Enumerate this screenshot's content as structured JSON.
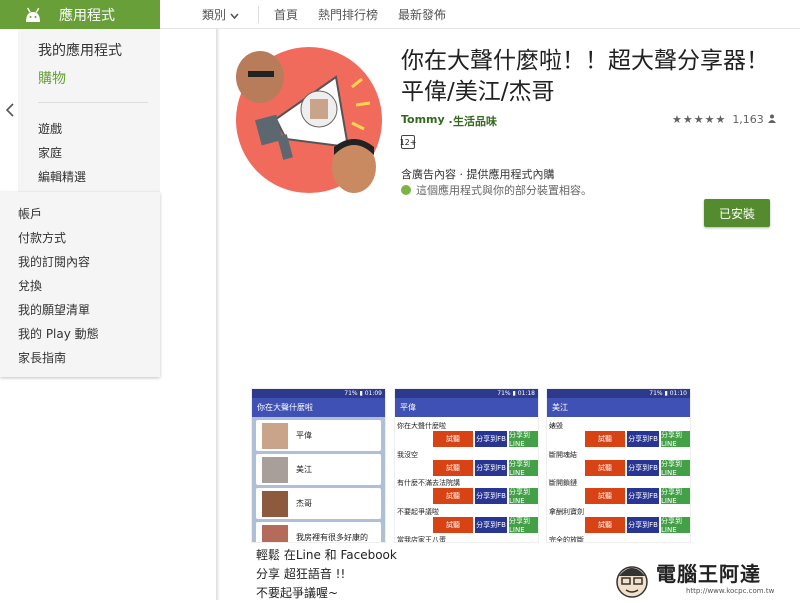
{
  "header": {
    "brand_title": "應用程式",
    "nav": [
      "類別",
      "首頁",
      "熱門排行榜",
      "最新發佈"
    ]
  },
  "sidebar": {
    "top_items": [
      "我的應用程式",
      "購物"
    ],
    "sub_items": [
      "遊戲",
      "家庭",
      "編輯精選"
    ],
    "account_items": [
      "帳戶",
      "付款方式",
      "我的訂閱內容",
      "兌換",
      "我的願望清單",
      "我的 Play 動態",
      "家長指南"
    ]
  },
  "app": {
    "title": "你在大聲什麼啦！！超大聲分享器！平偉/美江/杰哥",
    "developer": "Tommy .",
    "category": "生活品味",
    "stars": "★★★★★",
    "rating_count": "1,163",
    "age_rating": "12+",
    "ads_notice": "含廣告內容 · 提供應用程式內購",
    "compat_notice": "這個應用程式與你的部分裝置相容。",
    "install_label": "已安裝"
  },
  "screenshots": {
    "s1": {
      "status": "71% ▮ 01:09",
      "title": "你在大聲什麼啦",
      "items": [
        "平偉",
        "美江",
        "杰哥",
        "我房裡有很多好康的"
      ]
    },
    "s2": {
      "status": "71% ▮ 01:18",
      "title": "平偉",
      "rows": [
        "你在大聲什麼啦",
        "我沒空",
        "有什麼不滿去法院講",
        "不要起爭議啦",
        "當我店家王八蛋"
      ]
    },
    "s3": {
      "status": "71% ▮ 01:10",
      "title": "美江",
      "rows": [
        "婊毀",
        "斷開魂結",
        "斷開鎖鏈",
        "拿酬利寶劍",
        "完全的放斷"
      ]
    },
    "btn_listen": "試聽",
    "btn_fb": "分享到FB",
    "btn_line": "分享到LINE"
  },
  "description": {
    "lines": [
      "輕鬆 在Line 和 Facebook",
      "分享 超狂語音 !!",
      "不要起爭議喔~"
    ]
  },
  "watermark": {
    "title": "電腦王阿達",
    "url": "http://www.kocpc.com.tw"
  },
  "colors": {
    "brand_green": "#689f38",
    "install_green": "#558b2f",
    "icon_bg": "#f16b5c",
    "dev_green": "#33691e"
  }
}
